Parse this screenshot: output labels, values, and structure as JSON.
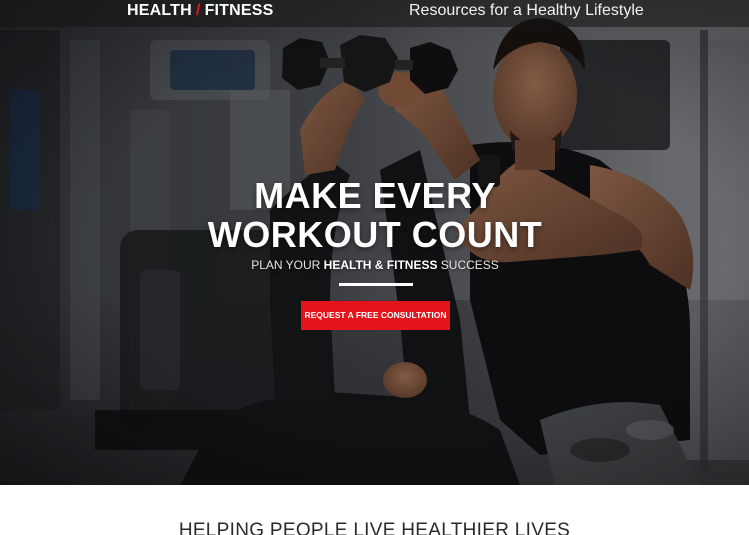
{
  "header": {
    "brand_left": "HEALTH",
    "brand_separator": "/",
    "brand_right": "FITNESS",
    "tagline": "Resources for a Healthy Lifestyle"
  },
  "hero": {
    "headline_line1": "MAKE EVERY",
    "headline_line2": "WORKOUT COUNT",
    "subhead_prefix": "PLAN YOUR",
    "subhead_emphasis": "HEALTH & FITNESS",
    "subhead_suffix": "SUCCESS",
    "cta_label": "REQUEST A FREE CONSULTATION",
    "image_subject": "trainer-spotting-dumbbell-press-photo"
  },
  "section": {
    "title": "HELPING PEOPLE LIVE HEALTHIER LIVES"
  },
  "colors": {
    "accent": "#e3141c",
    "hero_text": "#ffffff",
    "section_text": "#2a2a2a"
  }
}
